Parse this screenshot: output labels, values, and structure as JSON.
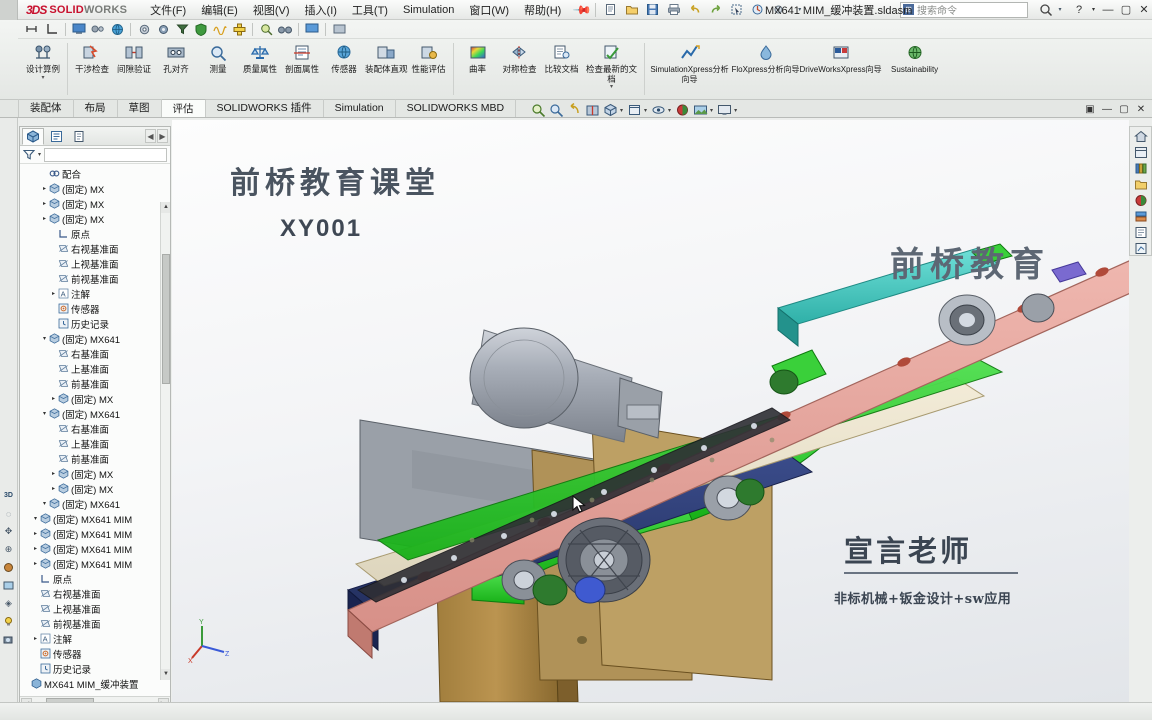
{
  "app": {
    "brand_ds": "3DS",
    "brand_solid": "SOLID",
    "brand_works": "WORKS",
    "document_title": "MX641 MIM_缓冲装置.sldasm",
    "accent_red": "#c8102e"
  },
  "menu": {
    "items": [
      {
        "label": "文件(F)"
      },
      {
        "label": "编辑(E)"
      },
      {
        "label": "视图(V)"
      },
      {
        "label": "插入(I)"
      },
      {
        "label": "工具(T)"
      },
      {
        "label": "Simulation"
      },
      {
        "label": "窗口(W)"
      },
      {
        "label": "帮助(H)"
      }
    ],
    "pin_icon": "pin-icon"
  },
  "quick_access": {
    "buttons": [
      {
        "name": "new-document-icon",
        "glyph": "🗋"
      },
      {
        "name": "open-document-icon",
        "glyph": "📂"
      },
      {
        "name": "save-icon",
        "glyph": "💾"
      },
      {
        "name": "print-icon",
        "glyph": "🖨"
      },
      {
        "name": "undo-icon",
        "glyph": "↩"
      },
      {
        "name": "redo-icon",
        "glyph": "↪"
      },
      {
        "name": "select-icon",
        "glyph": "▣"
      },
      {
        "name": "rebuild-icon",
        "glyph": "◍"
      },
      {
        "name": "options-icon",
        "glyph": "⚙"
      }
    ]
  },
  "search": {
    "placeholder": "搜索命令",
    "icon": "search-icon",
    "dropdown_icon": "chevron-down-icon"
  },
  "window_controls": {
    "help": "?",
    "help_caret": "▾",
    "minimize": "—",
    "maximize": "▢",
    "close": "✕"
  },
  "command_bar": {
    "icons": [
      {
        "name": "measure-tool-icon",
        "glyph": "⊢"
      },
      {
        "name": "angle-tool-icon",
        "glyph": "∟"
      },
      {
        "name": "display-state-icon",
        "glyph": "🖥"
      },
      {
        "name": "assembly-visualization-icon",
        "glyph": "⚒"
      },
      {
        "name": "globe-icon",
        "glyph": "🌐"
      },
      {
        "name": "gear-icon",
        "glyph": "⚙"
      },
      {
        "name": "component-icon",
        "glyph": "🧩"
      },
      {
        "name": "filter-funnel-icon",
        "glyph": "▼"
      },
      {
        "name": "shield-icon",
        "glyph": "🛡"
      },
      {
        "name": "curve-icon",
        "glyph": "〰"
      },
      {
        "name": "mate-icon",
        "glyph": "✥"
      },
      {
        "name": "zoom-icon",
        "glyph": "🔍"
      },
      {
        "name": "binoculars-icon",
        "glyph": "🔭"
      },
      {
        "name": "screen-icon",
        "glyph": "🖵"
      }
    ]
  },
  "ribbon": {
    "groups": [
      {
        "buttons": [
          {
            "name": "design-study-button",
            "label": "设计算例",
            "glyph": "⚗",
            "icon": "design-study-icon",
            "caret": true,
            "wide": false
          }
        ]
      },
      {
        "buttons": [
          {
            "name": "interference-detection-button",
            "label": "干涉检查",
            "glyph": "⚡",
            "icon": "interference-icon"
          },
          {
            "name": "clearance-verification-button",
            "label": "间隙验证",
            "glyph": "⚖",
            "icon": "clearance-icon"
          },
          {
            "name": "hole-alignment-button",
            "label": "孔对齐",
            "glyph": "🕳",
            "icon": "hole-align-icon"
          },
          {
            "name": "measure-button",
            "label": "测量",
            "glyph": "🔎",
            "icon": "measure-icon"
          },
          {
            "name": "mass-properties-button",
            "label": "质量属性",
            "glyph": "⚓",
            "icon": "mass-properties-icon"
          },
          {
            "name": "section-properties-button",
            "label": "剖面属性",
            "glyph": "📐",
            "icon": "section-properties-icon"
          },
          {
            "name": "sensor-button",
            "label": "传感器",
            "glyph": "🌍",
            "icon": "sensor-icon"
          },
          {
            "name": "assembly-visualization-button",
            "label": "装配体直观",
            "glyph": "📊",
            "icon": "assembly-vis-icon"
          },
          {
            "name": "performance-evaluation-button",
            "label": "性能评估",
            "glyph": "🔋",
            "icon": "performance-icon"
          }
        ]
      },
      {
        "buttons": [
          {
            "name": "curvature-button",
            "label": "曲率",
            "glyph": "🌈",
            "icon": "curvature-icon"
          },
          {
            "name": "symmetry-check-button",
            "label": "对称检查",
            "glyph": "🪞",
            "icon": "symmetry-icon"
          },
          {
            "name": "compare-documents-button",
            "label": "比较文档",
            "glyph": "📄",
            "icon": "compare-icon"
          },
          {
            "name": "check-updated-documents-button",
            "label": "检查最新的文档",
            "glyph": "✅",
            "icon": "check-updated-icon",
            "caret": true
          }
        ]
      },
      {
        "buttons": [
          {
            "name": "simulationxpress-button",
            "label": "SimulationXpress分析向导",
            "glyph": "📈",
            "icon": "simulationxpress-icon",
            "wide": true
          },
          {
            "name": "floxpress-button",
            "label": "FloXpress分析向导",
            "glyph": "💧",
            "icon": "floxpress-icon",
            "wide": true
          },
          {
            "name": "driveworksxpress-button",
            "label": "DriveWorksXpress向导",
            "glyph": "🗂",
            "icon": "driveworksxpress-icon",
            "wide": true
          },
          {
            "name": "sustainability-button",
            "label": "Sustainability",
            "glyph": "🌐",
            "icon": "sustainability-icon",
            "wide": true
          }
        ]
      }
    ]
  },
  "tabs": {
    "items": [
      {
        "label": "装配体",
        "active": false
      },
      {
        "label": "布局",
        "active": false
      },
      {
        "label": "草图",
        "active": false
      },
      {
        "label": "评估",
        "active": true
      },
      {
        "label": "SOLIDWORKS 插件",
        "active": false
      },
      {
        "label": "Simulation",
        "active": false
      },
      {
        "label": "SOLIDWORKS MBD",
        "active": false
      }
    ]
  },
  "view_toolbar": {
    "icons": [
      {
        "name": "zoom-to-fit-icon",
        "glyph": "🔍",
        "caret": false
      },
      {
        "name": "zoom-to-area-icon",
        "glyph": "🔎",
        "caret": false
      },
      {
        "name": "previous-view-icon",
        "glyph": "↩",
        "caret": false
      },
      {
        "name": "section-view-icon",
        "glyph": "🧊",
        "caret": false
      },
      {
        "name": "view-orientation-icon",
        "glyph": "🧭",
        "caret": true
      },
      {
        "name": "display-style-icon",
        "glyph": "⬜",
        "caret": true
      },
      {
        "name": "hide-show-items-icon",
        "glyph": "👁",
        "caret": true
      },
      {
        "name": "appearances-icon",
        "glyph": "🎨",
        "caret": false
      },
      {
        "name": "scene-icon",
        "glyph": "🏞",
        "caret": true
      },
      {
        "name": "view-settings-icon",
        "glyph": "🖵",
        "caret": true
      }
    ]
  },
  "document_window_controls": {
    "buttons": [
      {
        "name": "doc-restore-down-button",
        "glyph": "▣"
      },
      {
        "name": "doc-minimize-button",
        "glyph": "—"
      },
      {
        "name": "doc-maximize-button",
        "glyph": "▢"
      },
      {
        "name": "doc-close-button",
        "glyph": "✕"
      }
    ]
  },
  "feature_manager": {
    "tabs": [
      {
        "name": "feature-tree-tab",
        "glyph": "🧊",
        "active": true
      },
      {
        "name": "property-manager-tab",
        "glyph": "▤",
        "active": false
      },
      {
        "name": "configuration-manager-tab",
        "glyph": "📑",
        "active": false
      }
    ],
    "nav_left": "◀",
    "nav_right": "▶",
    "filter_icon": "filter-funnel-icon",
    "filter_caret": "▾",
    "tree": [
      {
        "depth": 0,
        "expand": "",
        "icon": "assembly-icon",
        "glyph": "🧊",
        "label": "MX641 MIM_缓冲装置"
      },
      {
        "depth": 1,
        "expand": "",
        "icon": "history-icon",
        "glyph": "🕘",
        "label": "历史记录"
      },
      {
        "depth": 1,
        "expand": "",
        "icon": "sensor-icon",
        "glyph": "◎",
        "label": "传感器"
      },
      {
        "depth": 1,
        "expand": "▸",
        "icon": "annotations-icon",
        "glyph": "🅰",
        "label": "注解"
      },
      {
        "depth": 1,
        "expand": "",
        "icon": "plane-icon",
        "glyph": "◫",
        "label": "前视基准面"
      },
      {
        "depth": 1,
        "expand": "",
        "icon": "plane-icon",
        "glyph": "◫",
        "label": "上视基准面"
      },
      {
        "depth": 1,
        "expand": "",
        "icon": "plane-icon",
        "glyph": "◫",
        "label": "右视基准面"
      },
      {
        "depth": 1,
        "expand": "",
        "icon": "origin-icon",
        "glyph": "⌐",
        "label": "原点"
      },
      {
        "depth": 1,
        "expand": "▸",
        "icon": "component-icon",
        "glyph": "🧩",
        "label": "(固定) MX641 MIM"
      },
      {
        "depth": 1,
        "expand": "▸",
        "icon": "component-icon",
        "glyph": "🧩",
        "label": "(固定) MX641 MIM"
      },
      {
        "depth": 1,
        "expand": "▸",
        "icon": "component-icon",
        "glyph": "🧩",
        "label": "(固定) MX641 MIM"
      },
      {
        "depth": 1,
        "expand": "▾",
        "icon": "component-icon",
        "glyph": "🧩",
        "label": "(固定) MX641 MIM"
      },
      {
        "depth": 2,
        "expand": "▾",
        "icon": "component-icon",
        "glyph": "🧩",
        "label": "(固定) MX641"
      },
      {
        "depth": 3,
        "expand": "▸",
        "icon": "component-icon",
        "glyph": "🧩",
        "label": "(固定) MX"
      },
      {
        "depth": 3,
        "expand": "▸",
        "icon": "component-icon",
        "glyph": "🧩",
        "label": "(固定) MX"
      },
      {
        "depth": 3,
        "expand": "",
        "icon": "plane-icon",
        "glyph": "◫",
        "label": "前基准面"
      },
      {
        "depth": 3,
        "expand": "",
        "icon": "plane-icon",
        "glyph": "◫",
        "label": "上基准面"
      },
      {
        "depth": 3,
        "expand": "",
        "icon": "plane-icon",
        "glyph": "◫",
        "label": "右基准面"
      },
      {
        "depth": 2,
        "expand": "▾",
        "icon": "component-icon",
        "glyph": "🧩",
        "label": "(固定) MX641"
      },
      {
        "depth": 3,
        "expand": "▸",
        "icon": "component-icon",
        "glyph": "🧩",
        "label": "(固定) MX"
      },
      {
        "depth": 3,
        "expand": "",
        "icon": "plane-icon",
        "glyph": "◫",
        "label": "前基准面"
      },
      {
        "depth": 3,
        "expand": "",
        "icon": "plane-icon",
        "glyph": "◫",
        "label": "上基准面"
      },
      {
        "depth": 3,
        "expand": "",
        "icon": "plane-icon",
        "glyph": "◫",
        "label": "右基准面"
      },
      {
        "depth": 2,
        "expand": "▾",
        "icon": "component-icon",
        "glyph": "🧊",
        "label": "(固定) MX641"
      },
      {
        "depth": 3,
        "expand": "",
        "icon": "history-icon",
        "glyph": "🕘",
        "label": "历史记录"
      },
      {
        "depth": 3,
        "expand": "",
        "icon": "sensor-icon",
        "glyph": "◎",
        "label": "传感器"
      },
      {
        "depth": 3,
        "expand": "▸",
        "icon": "annotations-icon",
        "glyph": "🅰",
        "label": "注解"
      },
      {
        "depth": 3,
        "expand": "",
        "icon": "plane-icon",
        "glyph": "◫",
        "label": "前视基准面"
      },
      {
        "depth": 3,
        "expand": "",
        "icon": "plane-icon",
        "glyph": "◫",
        "label": "上视基准面"
      },
      {
        "depth": 3,
        "expand": "",
        "icon": "plane-icon",
        "glyph": "◫",
        "label": "右视基准面"
      },
      {
        "depth": 3,
        "expand": "",
        "icon": "origin-icon",
        "glyph": "⌐",
        "label": "原点"
      },
      {
        "depth": 2,
        "expand": "▸",
        "icon": "component-icon",
        "glyph": "🧩",
        "label": "(固定) MX"
      },
      {
        "depth": 2,
        "expand": "▸",
        "icon": "component-icon",
        "glyph": "🧩",
        "label": "(固定) MX"
      },
      {
        "depth": 2,
        "expand": "▸",
        "icon": "component-icon",
        "glyph": "🧩",
        "label": "(固定) MX"
      },
      {
        "depth": 2,
        "expand": "",
        "icon": "mates-icon",
        "glyph": "⛓",
        "label": "配合"
      }
    ],
    "hscroll": {
      "left_arrow": "◀",
      "right_arrow": "▶"
    },
    "vscroll": {
      "up_arrow": "▲",
      "down_arrow": "▼"
    }
  },
  "left_rail": {
    "icons": [
      {
        "name": "3d-mode-icon",
        "glyph": "3D"
      },
      {
        "name": "view-rotate-icon",
        "glyph": "◌"
      },
      {
        "name": "pan-icon",
        "glyph": "✥"
      },
      {
        "name": "zoom-rail-icon",
        "glyph": "⊕"
      },
      {
        "name": "appearance-rail-icon",
        "glyph": "🎨"
      },
      {
        "name": "scene-rail-icon",
        "glyph": "🖼"
      },
      {
        "name": "decal-rail-icon",
        "glyph": "◈"
      },
      {
        "name": "light-rail-icon",
        "glyph": "💡"
      },
      {
        "name": "camera-rail-icon",
        "glyph": "📷"
      }
    ]
  },
  "right_rail": {
    "icons": [
      {
        "name": "home-icon",
        "glyph": "⌂"
      },
      {
        "name": "task-pane-library-icon",
        "glyph": "🗄"
      },
      {
        "name": "design-library-icon",
        "glyph": "📚"
      },
      {
        "name": "file-explorer-icon",
        "glyph": "🗂"
      },
      {
        "name": "view-palette-icon",
        "glyph": "🎨"
      },
      {
        "name": "appearances-pane-icon",
        "glyph": "🖌"
      },
      {
        "name": "custom-properties-icon",
        "glyph": "▤"
      },
      {
        "name": "drawing-pane-icon",
        "glyph": "📐"
      }
    ]
  },
  "graphics": {
    "watermarks": {
      "title": "前桥教育课堂",
      "code": "XY001",
      "brand": "前桥教育",
      "teacher": "宣言老师",
      "teacher_sub": "非标机械+钣金设计+sw应用"
    },
    "triad": {
      "x": "X",
      "y": "Y",
      "z": "Z"
    },
    "cursor": "cursor-pointer-icon"
  },
  "status_bar": {
    "scroll_left": "◀",
    "scroll_right": "▶",
    "scroll_dots": "|||"
  }
}
